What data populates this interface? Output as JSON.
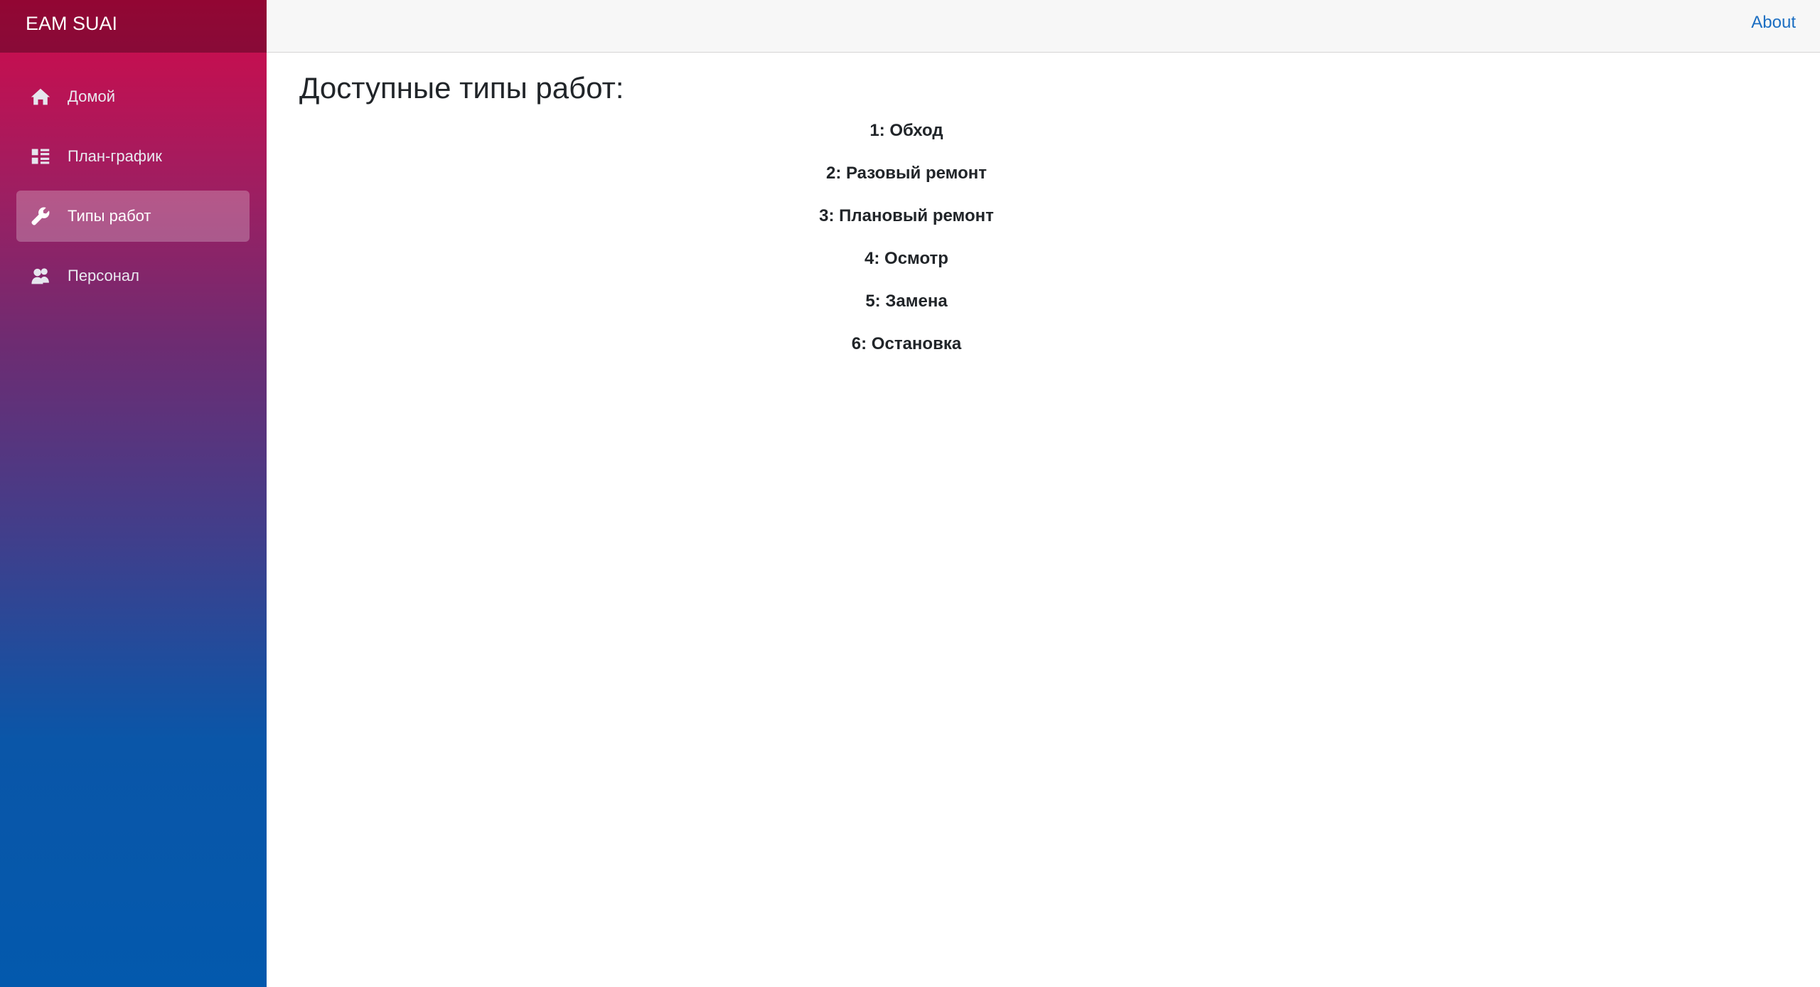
{
  "brand": "EAM SUAI",
  "header": {
    "about_label": "About"
  },
  "sidebar": {
    "items": [
      {
        "label": "Домой",
        "icon": "home-icon",
        "active": false
      },
      {
        "label": "План-график",
        "icon": "schedule-list-icon",
        "active": false
      },
      {
        "label": "Типы работ",
        "icon": "wrench-icon",
        "active": true
      },
      {
        "label": "Персонал",
        "icon": "people-icon",
        "active": false
      }
    ]
  },
  "main": {
    "title": "Доступные типы работ:",
    "work_types": [
      "1: Обход",
      "2: Разовый ремонт",
      "3: Плановый ремонт",
      "4: Осмотр",
      "5: Замена",
      "6: Остановка"
    ]
  },
  "colors": {
    "sidebar_top": "#d20a4a",
    "sidebar_bottom": "#0359ad",
    "link": "#1b6ec2",
    "topbar_bg": "#f7f7f7"
  }
}
